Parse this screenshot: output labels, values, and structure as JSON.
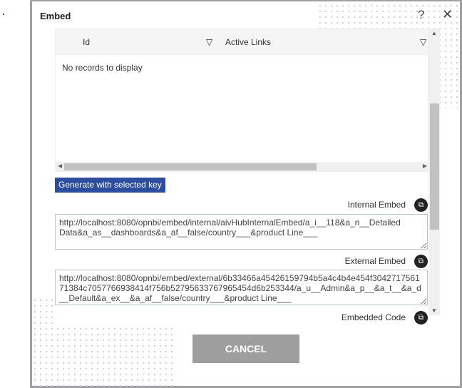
{
  "dialog": {
    "title": "Embed",
    "help_icon": "question-icon",
    "close_icon": "close-icon"
  },
  "grid": {
    "columns": [
      "Id",
      "Active Links"
    ],
    "empty_message": "No records to display"
  },
  "generate_button": "Generate with selected key",
  "internal": {
    "label": "Internal Embed",
    "value": "http://localhost:8080/opnbi/embed/internal/aivHubInternalEmbed/a_i__118&a_n__Detailed Data&a_as__dashboards&a_af__false/country___&product Line___"
  },
  "external": {
    "label": "External Embed",
    "value": "http://localhost:8080/opnbi/embed/external/6b33466a45426159794b5a4c4b4e454f304271756171384c7057766938414f756b52795633767965454d6b253344/a_u__Admin&a_p__&a_t__&a_d__Default&a_ex__&a_af__false/country___&product Line___"
  },
  "embedded_code": {
    "label": "Embedded Code"
  },
  "cancel_button": "CANCEL",
  "colors": {
    "primary": "#2d4d9e",
    "cancel": "#9e9e9e"
  }
}
